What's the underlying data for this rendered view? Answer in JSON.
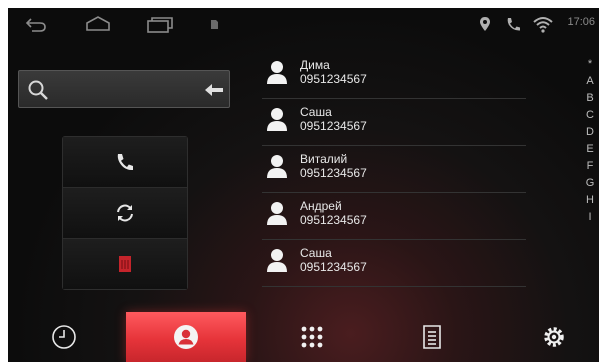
{
  "status_bar": {
    "time": "17:06",
    "nav_icons": [
      "back-arrow-icon",
      "home-icon",
      "recent-apps-icon",
      "sd-card-icon"
    ],
    "status_icons": [
      "location-pin-icon",
      "phone-call-icon",
      "wifi-icon"
    ]
  },
  "search": {
    "value": "",
    "placeholder": ""
  },
  "actions": [
    {
      "icon": "phone-call-icon"
    },
    {
      "icon": "sync-icon"
    },
    {
      "icon": "delete-icon",
      "color": "#d0262e"
    }
  ],
  "contacts": [
    {
      "name": "Дима",
      "number": "0951234567"
    },
    {
      "name": "Саша",
      "number": "0951234567"
    },
    {
      "name": "Виталий",
      "number": "0951234567"
    },
    {
      "name": "Андрей",
      "number": "0951234567"
    },
    {
      "name": "Саша",
      "number": "0951234567"
    }
  ],
  "alphabet_index": [
    "*",
    "A",
    "B",
    "C",
    "D",
    "E",
    "F",
    "G",
    "H",
    "I"
  ],
  "bottom_tabs": [
    {
      "icon": "call-history-icon",
      "active": false
    },
    {
      "icon": "contacts-icon",
      "active": true
    },
    {
      "icon": "dialpad-icon",
      "active": false
    },
    {
      "icon": "phonebook-sync-icon",
      "active": false
    },
    {
      "icon": "settings-icon",
      "active": false
    }
  ],
  "colors": {
    "accent": "#e6343a",
    "text": "#e8e8e8",
    "background": "#0c0c0c"
  }
}
